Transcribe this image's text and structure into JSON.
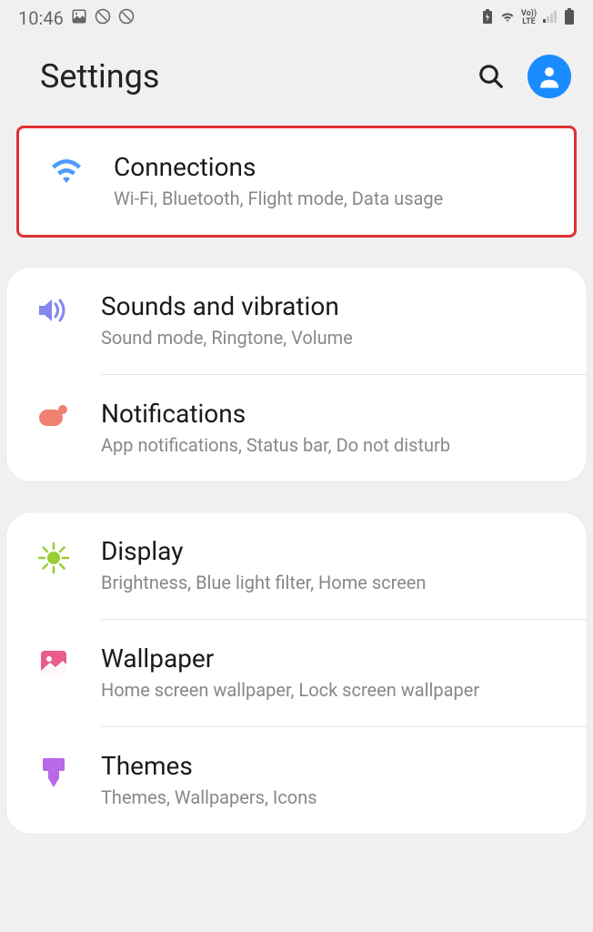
{
  "status": {
    "time": "10:46"
  },
  "header": {
    "title": "Settings"
  },
  "sections": [
    {
      "items": [
        {
          "title": "Connections",
          "subtitle": "Wi-Fi, Bluetooth, Flight mode, Data usage"
        }
      ]
    },
    {
      "items": [
        {
          "title": "Sounds and vibration",
          "subtitle": "Sound mode, Ringtone, Volume"
        },
        {
          "title": "Notifications",
          "subtitle": "App notifications, Status bar, Do not disturb"
        }
      ]
    },
    {
      "items": [
        {
          "title": "Display",
          "subtitle": "Brightness, Blue light filter, Home screen"
        },
        {
          "title": "Wallpaper",
          "subtitle": "Home screen wallpaper, Lock screen wallpaper"
        },
        {
          "title": "Themes",
          "subtitle": "Themes, Wallpapers, Icons"
        }
      ]
    }
  ]
}
